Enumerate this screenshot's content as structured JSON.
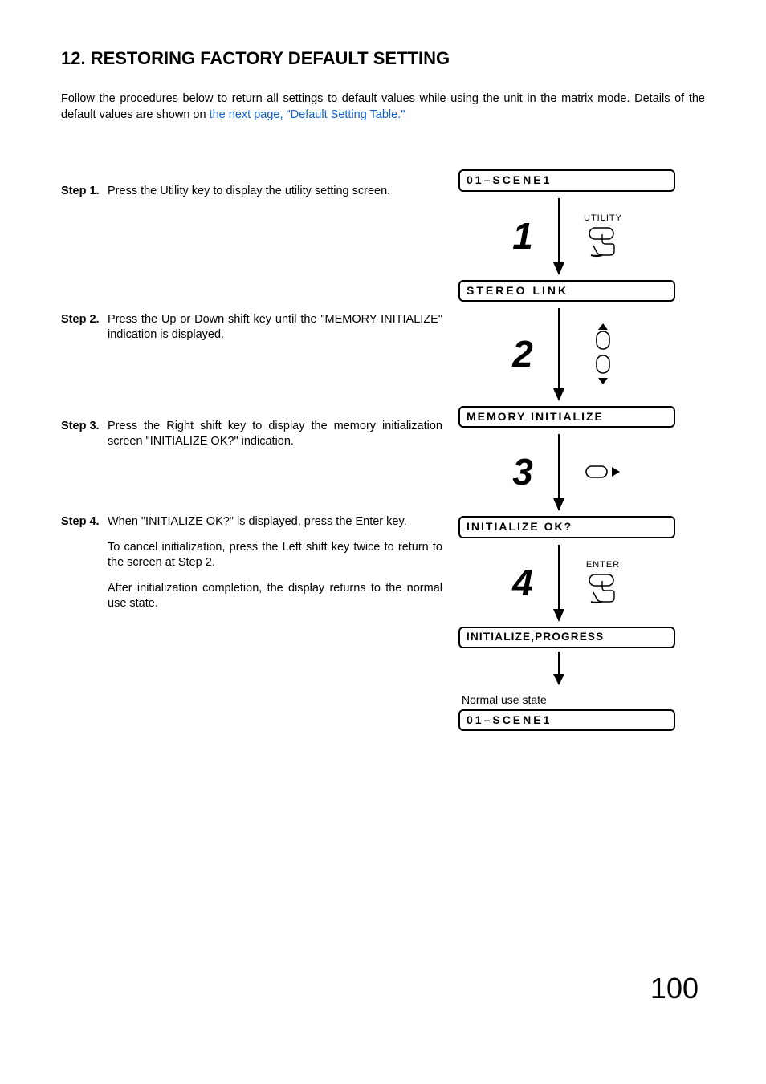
{
  "title": "12. RESTORING FACTORY DEFAULT SETTING",
  "intro_plain": "Follow the procedures below to return all settings to default values while using the unit in the matrix mode. Details of the default values are shown on ",
  "intro_link": "the next page, \"Default Setting Table.\"",
  "steps": {
    "s1": {
      "label": "Step 1.",
      "p1": "Press the Utility key to display the utility setting screen."
    },
    "s2": {
      "label": "Step 2.",
      "p1": "Press the Up or Down shift key until the \"MEMORY INITIALIZE\" indication is displayed."
    },
    "s3": {
      "label": "Step 3.",
      "p1": "Press the Right shift key to display the memory initialization screen \"INITIALIZE OK?\" indication."
    },
    "s4": {
      "label": "Step 4.",
      "p1": "When \"INITIALIZE OK?\" is displayed, press the Enter key.",
      "p2": "To cancel initialization, press the Left shift key twice to return to the screen at Step 2.",
      "p3": "After initialization completion, the display returns to the normal use state."
    }
  },
  "displays": {
    "d1": "01–SCENE1",
    "d2": "STEREO LINK",
    "d3": "MEMORY INITIALIZE",
    "d4": "INITIALIZE OK?",
    "d5": "INITIALIZE,PROGRESS",
    "d6": "01–SCENE1"
  },
  "arrows": {
    "n1": "1",
    "n2": "2",
    "n3": "3",
    "n4": "4"
  },
  "key_labels": {
    "utility": "UTILITY",
    "enter": "ENTER"
  },
  "normal_state_caption": "Normal use state",
  "page_number": "100"
}
